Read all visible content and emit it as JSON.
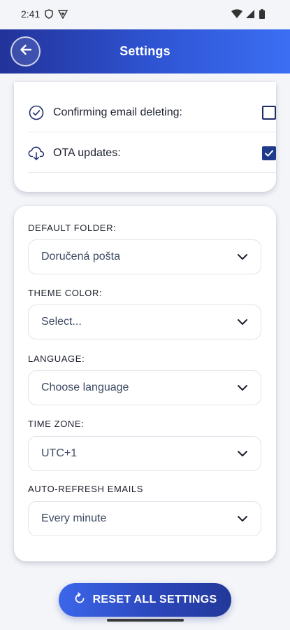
{
  "status_bar": {
    "time": "2:41",
    "icons": [
      "shield-icon",
      "vpn-icon",
      "wifi-icon",
      "signal-icon",
      "battery-icon"
    ]
  },
  "app_bar": {
    "title": "Settings",
    "back_icon": "arrow-left-icon"
  },
  "toggles": [
    {
      "label": "Confirming email deleting:",
      "icon": "check-circle-icon",
      "checked": false
    },
    {
      "label": "OTA updates:",
      "icon": "cloud-download-icon",
      "checked": true
    }
  ],
  "fields": [
    {
      "label": "DEFAULT FOLDER:",
      "value": "Doručená pošta"
    },
    {
      "label": "THEME COLOR:",
      "value": "Select..."
    },
    {
      "label": "LANGUAGE:",
      "value": "Choose language"
    },
    {
      "label": "TIME ZONE:",
      "value": "UTC+1"
    },
    {
      "label": "AUTO-REFRESH EMAILS",
      "value": "Every minute"
    }
  ],
  "reset": {
    "label": "RESET ALL SETTINGS",
    "icon": "refresh-icon"
  },
  "colors": {
    "primary_dark": "#22339a",
    "primary_light": "#3b6ef3",
    "checkbox": "#1f3a8a"
  }
}
